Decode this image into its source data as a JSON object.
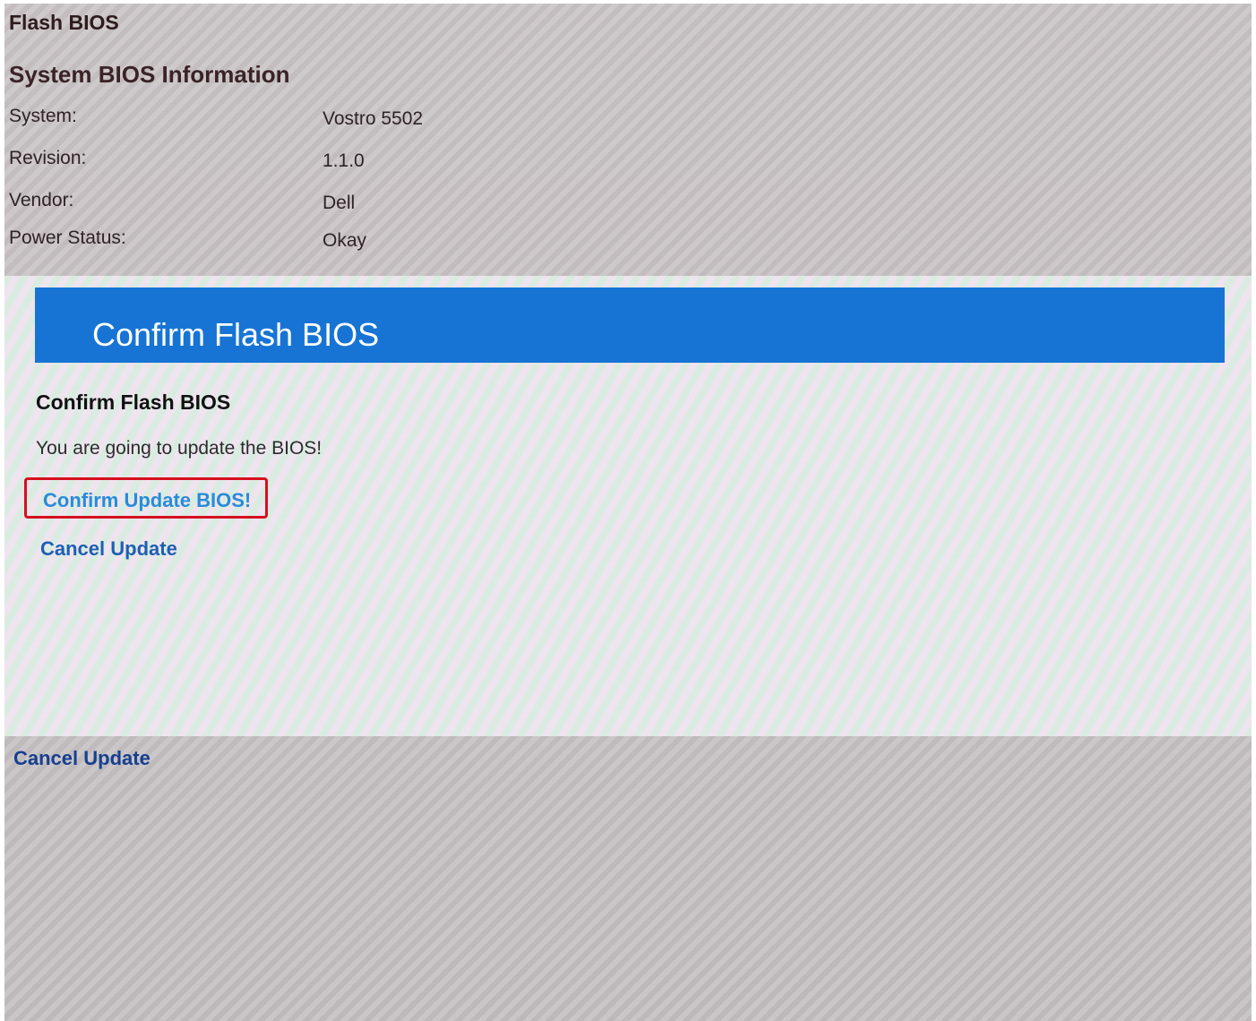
{
  "page": {
    "title": "Flash BIOS"
  },
  "system_info": {
    "section_title": "System BIOS Information",
    "rows": [
      {
        "label": "System:",
        "value": "Vostro 5502"
      },
      {
        "label": "Revision:",
        "value": "1.1.0"
      },
      {
        "label": "Vendor:",
        "value": "Dell"
      },
      {
        "label": "Power Status:",
        "value": "Okay"
      }
    ]
  },
  "dialog": {
    "banner_title": "Confirm Flash BIOS",
    "subtitle": "Confirm Flash BIOS",
    "message": "You are going to update the BIOS!",
    "confirm_label": "Confirm Update BIOS!",
    "cancel_label": "Cancel Update"
  },
  "footer": {
    "cancel_label": "Cancel Update"
  },
  "colors": {
    "banner": "#1774d4",
    "highlight_border": "#d6101e",
    "link_primary": "#2a8bd8",
    "link_secondary": "#1e5fb3"
  }
}
